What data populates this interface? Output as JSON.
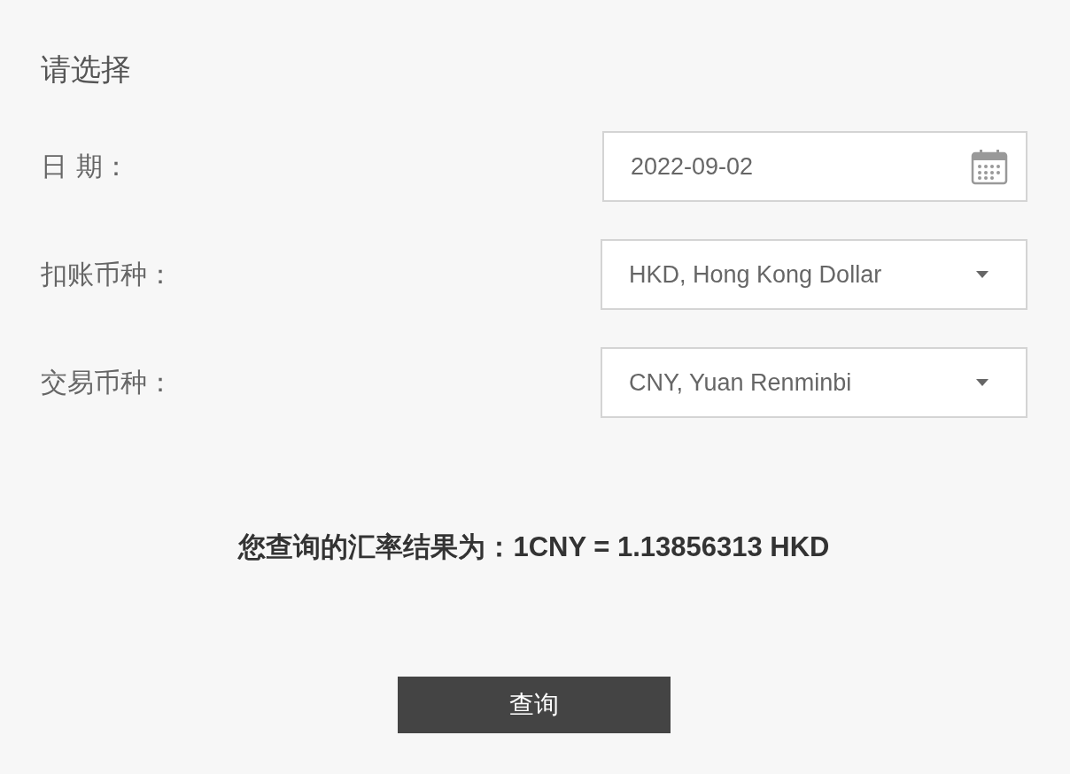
{
  "title": "请选择",
  "fields": [
    {
      "kind": "date",
      "label": "日 期：",
      "value": "2022-09-02"
    },
    {
      "kind": "select",
      "label": "扣账币种：",
      "value": "HKD, Hong Kong Dollar"
    },
    {
      "kind": "select",
      "label": "交易币种：",
      "value": "CNY, Yuan Renminbi"
    }
  ],
  "result": "您查询的汇率结果为：1CNY = 1.13856313 HKD",
  "button": "查询"
}
